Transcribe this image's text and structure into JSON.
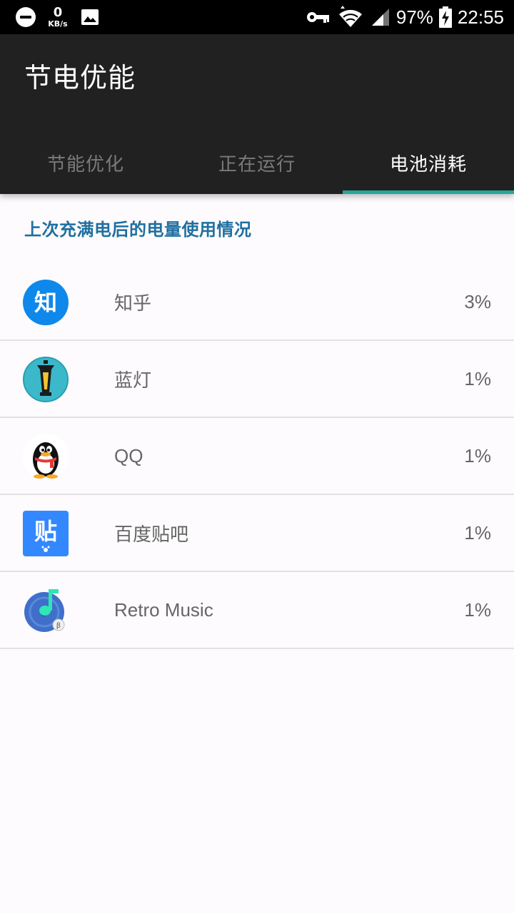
{
  "status_bar": {
    "net_speed_value": "0",
    "net_speed_unit": "KB/s",
    "battery_percent": "97%",
    "time": "22:55"
  },
  "app_bar": {
    "title": "节电优能",
    "tabs": [
      {
        "label": "节能优化",
        "active": false
      },
      {
        "label": "正在运行",
        "active": false
      },
      {
        "label": "电池消耗",
        "active": true
      }
    ]
  },
  "content": {
    "section_header": "上次充满电后的电量使用情况",
    "apps": [
      {
        "name": "知乎",
        "percent": "3%",
        "icon": "zhihu-icon"
      },
      {
        "name": "蓝灯",
        "percent": "1%",
        "icon": "lantern-icon"
      },
      {
        "name": "QQ",
        "percent": "1%",
        "icon": "qq-penguin-icon"
      },
      {
        "name": "百度贴吧",
        "percent": "1%",
        "icon": "tieba-icon"
      },
      {
        "name": "Retro Music",
        "percent": "1%",
        "icon": "retro-music-icon"
      }
    ]
  },
  "icon_glyphs": {
    "zhihu": "知",
    "tieba": "贴",
    "retro_badge": "β"
  },
  "colors": {
    "app_bar": "#212121",
    "tab_indicator": "#26a69a",
    "section_header": "#1f6fa0",
    "zhihu_blue": "#0f88eb",
    "tieba_blue": "#3388ff"
  }
}
